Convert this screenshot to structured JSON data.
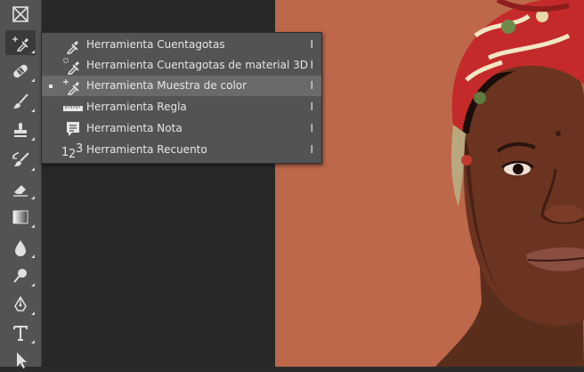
{
  "toolbar": {
    "tools": [
      {
        "icon": "artboard-icon"
      },
      {
        "icon": "eyedropper-icon",
        "active": true
      },
      {
        "icon": "healing-brush-icon"
      },
      {
        "icon": "brush-icon"
      },
      {
        "icon": "clone-stamp-icon"
      },
      {
        "icon": "history-brush-icon"
      },
      {
        "icon": "eraser-icon"
      },
      {
        "icon": "gradient-icon"
      },
      {
        "icon": "blur-icon"
      },
      {
        "icon": "dodge-icon"
      },
      {
        "icon": "pen-icon"
      },
      {
        "icon": "type-icon"
      },
      {
        "icon": "path-selection-icon"
      }
    ]
  },
  "flyout": {
    "items": [
      {
        "label": "Herramienta Cuentagotas",
        "shortcut": "I",
        "icon": "eyedropper-icon",
        "selected": false
      },
      {
        "label": "Herramienta Cuentagotas de material 3D",
        "shortcut": "I",
        "icon": "3d-material-eyedropper-icon",
        "selected": false
      },
      {
        "label": "Herramienta Muestra de color",
        "shortcut": "I",
        "icon": "color-sampler-icon",
        "selected": true
      },
      {
        "label": "Herramienta Regla",
        "shortcut": "I",
        "icon": "ruler-icon",
        "selected": false
      },
      {
        "label": "Herramienta Nota",
        "shortcut": "I",
        "icon": "note-icon",
        "selected": false
      },
      {
        "label": "Herramienta Recuento",
        "shortcut": "I",
        "icon": "count-icon",
        "count_glyph": "1₂3",
        "selected": false
      }
    ]
  },
  "canvas": {
    "background_color": "#bd674b"
  }
}
